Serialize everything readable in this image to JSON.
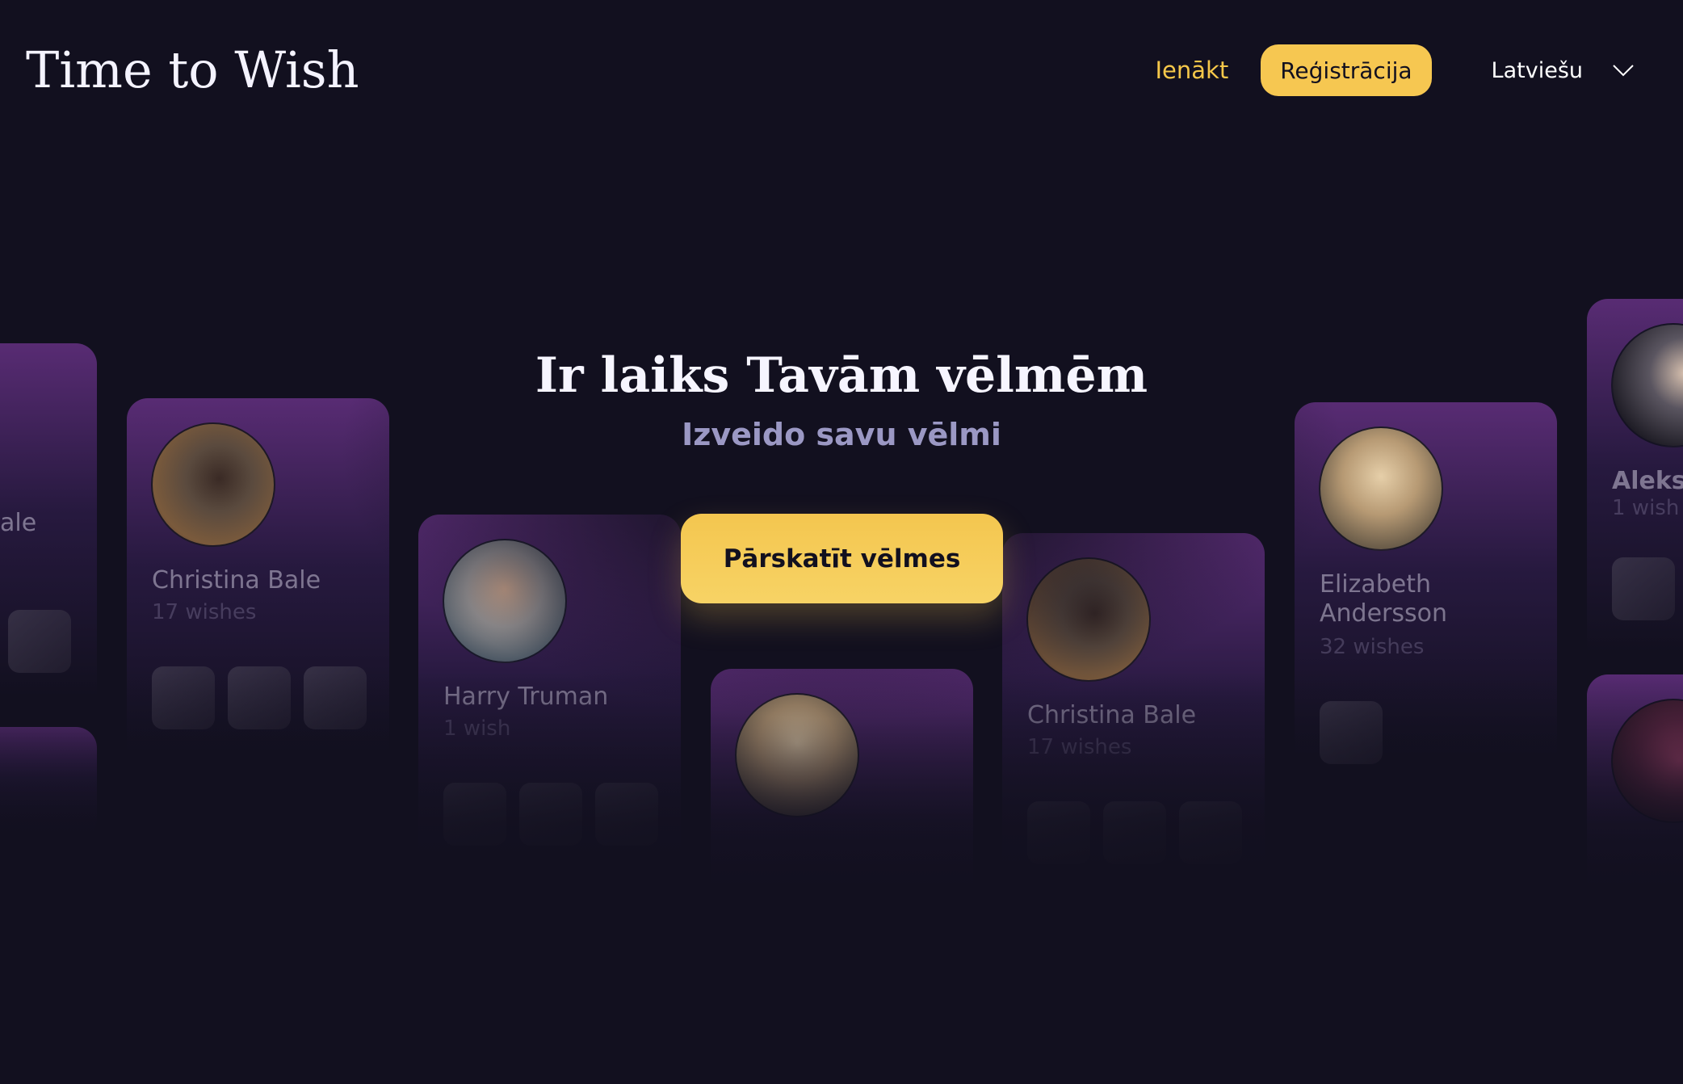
{
  "header": {
    "logo_text": "Time to Wish",
    "login_label": "Ienākt",
    "register_label": "Reģistrācija",
    "language": "Latviešu",
    "language_icon": "chevron-down-icon"
  },
  "hero": {
    "title": "Ir laiks Tavām vēlmēm",
    "subtitle": "Izveido savu vēlmi",
    "cta_label": "Pārskatīt vēlmes"
  },
  "cards": [
    {
      "name": "Christina Bale",
      "count": "17 wishes"
    },
    {
      "name": "Harry Truman",
      "count": "1 wish"
    },
    {
      "name": "Christina Bale",
      "count": "17 wishes"
    },
    {
      "name": "Elizabeth Andersson",
      "count": "32 wishes"
    },
    {
      "name": "Aleksi",
      "count": "1 wish"
    },
    {
      "name": "ale",
      "count": ""
    }
  ],
  "colors": {
    "background": "#12101f",
    "accent": "#f6c751",
    "subtitle": "#9b98c4"
  }
}
